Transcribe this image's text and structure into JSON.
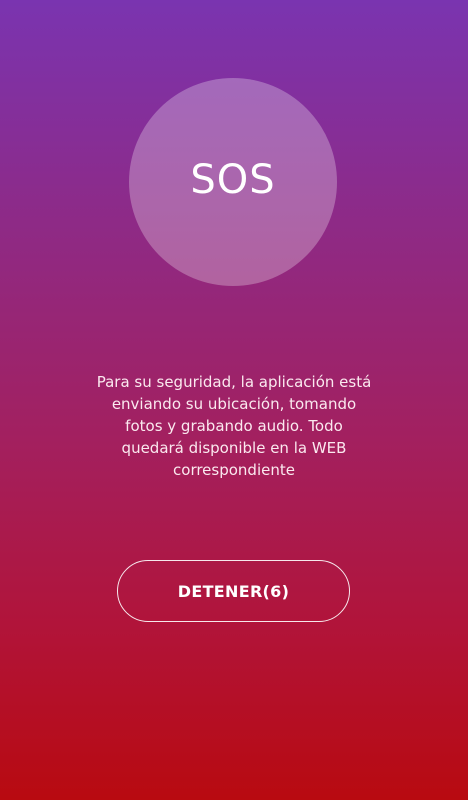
{
  "theme": {
    "gradient_top": "#7a34b0",
    "gradient_bottom": "#b80a10",
    "text_color": "#ffffff"
  },
  "sos": {
    "label": "SOS"
  },
  "message": {
    "line1": "Para su seguridad, la aplicación está",
    "line2": "enviando su ubicación, tomando",
    "line3": "fotos y grabando audio. Todo",
    "line4": "quedará disponible en la WEB",
    "line5": "correspondiente"
  },
  "stop_button": {
    "label": "DETENER(6)"
  }
}
